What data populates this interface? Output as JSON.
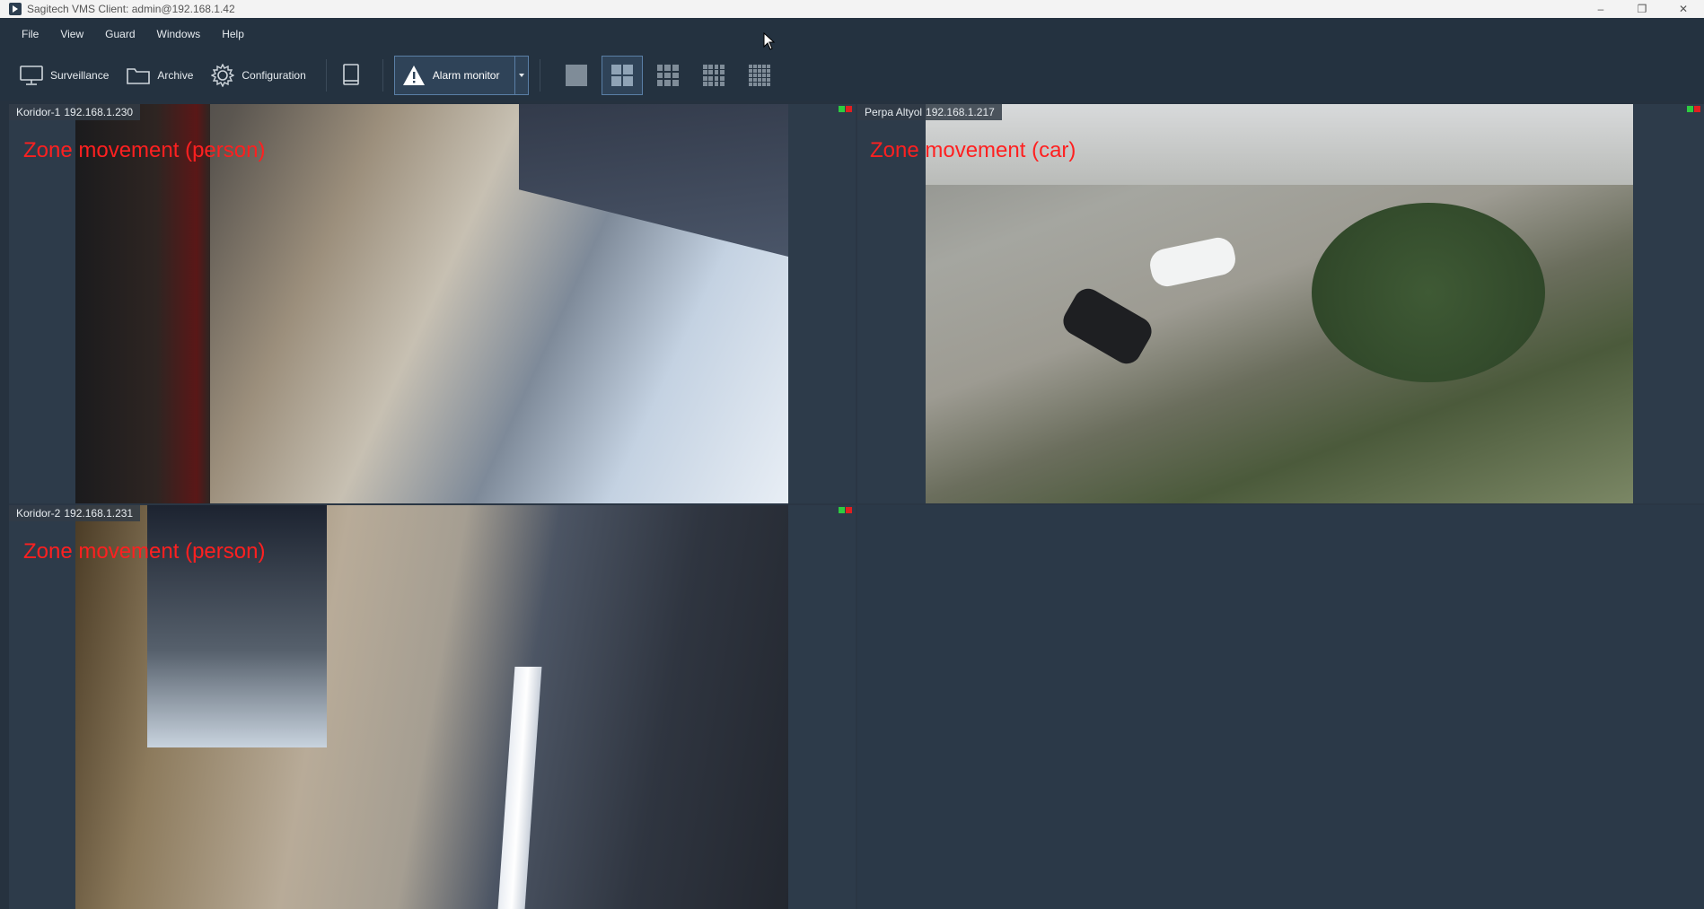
{
  "window": {
    "title": "Sagitech VMS Client: admin@192.168.1.42",
    "controls": [
      "–",
      "❐",
      "✕"
    ]
  },
  "menu": [
    "File",
    "View",
    "Guard",
    "Windows",
    "Help"
  ],
  "toolbar": {
    "surveillance": "Surveillance",
    "archive": "Archive",
    "configuration": "Configuration",
    "alarm_monitor": "Alarm monitor",
    "layouts": [
      "1x1",
      "2x2",
      "3x3",
      "4x4",
      "5x5"
    ],
    "active_layout": "2x2"
  },
  "tiles": [
    {
      "name": "Koridor-1",
      "ip": "192.168.1.230",
      "overlay": "Zone movement (person)"
    },
    {
      "name": "Perpa Altyol",
      "ip": "192.168.1.217",
      "overlay": "Zone movement (car)"
    },
    {
      "name": "Koridor-2",
      "ip": "192.168.1.231",
      "overlay": "Zone movement (person)"
    }
  ],
  "colors": {
    "background": "#26323f",
    "overlay_text": "#ff2020",
    "status_green": "#2ecc40",
    "status_red": "#e02020"
  }
}
